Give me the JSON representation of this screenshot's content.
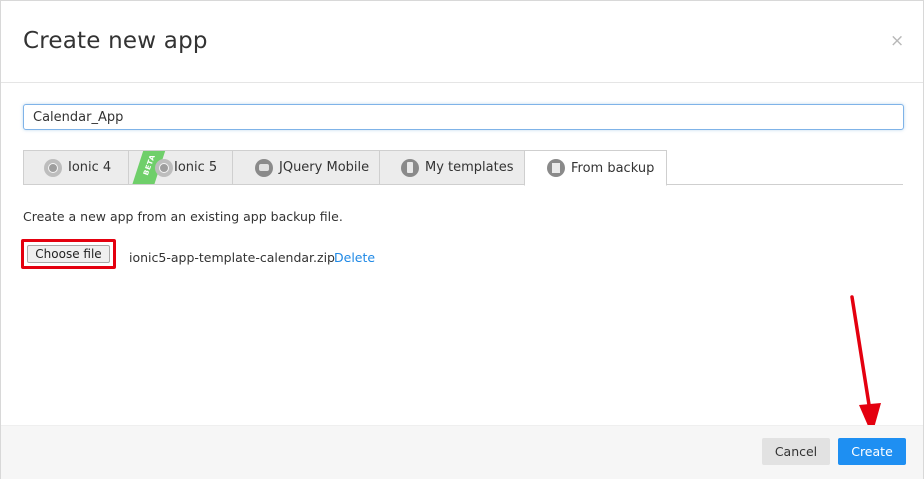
{
  "dialog": {
    "title": "Create new app",
    "close_symbol": "×"
  },
  "app_name": {
    "value": "Calendar_App"
  },
  "tabs": [
    {
      "label": "Ionic 4",
      "icon": "ionic-icon"
    },
    {
      "label": "Ionic 5",
      "icon": "ionic-icon",
      "badge": "BETA"
    },
    {
      "label": "JQuery Mobile",
      "icon": "jquery-mobile-icon"
    },
    {
      "label": "My templates",
      "icon": "phone-template-icon"
    },
    {
      "label": "From backup",
      "icon": "backup-file-icon",
      "active": true
    }
  ],
  "backup": {
    "description": "Create a new app from an existing app backup file.",
    "choose_file_label": "Choose file",
    "file_name": "ionic5-app-template-calendar.zip",
    "delete_label": "Delete"
  },
  "footer": {
    "cancel_label": "Cancel",
    "create_label": "Create"
  },
  "colors": {
    "accent": "#1e8ff2",
    "highlight_box": "#e4000f",
    "beta_badge": "#6fcf6a",
    "link": "#1e88e5"
  }
}
